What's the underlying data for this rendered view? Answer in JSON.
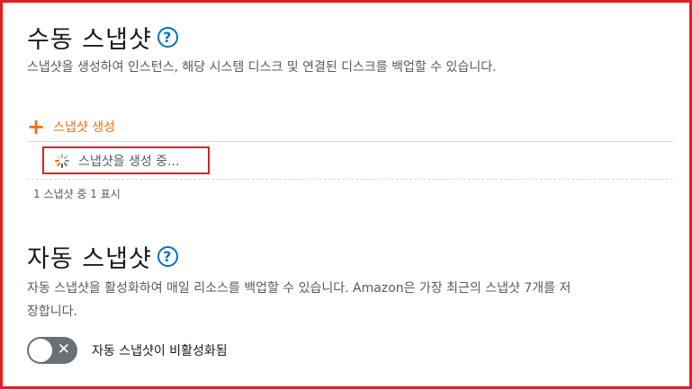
{
  "manual": {
    "title": "수동 스냅샷",
    "help_icon": "?",
    "description": "스냅샷을 생성하여 인스턴스, 해당 시스템 디스크 및 연결된 디스크를 백업할 수 있습니다.",
    "create_label": "스냅샷 생성",
    "create_icon": "plus-icon",
    "progress_label": "스냅샷을 생성 중...",
    "progress_icon": "spinner-icon",
    "count_text": "1 스냅샷 중 1 표시"
  },
  "automatic": {
    "title": "자동 스냅샷",
    "help_icon": "?",
    "description": "자동 스냅샷을 활성화하여 매일 리소스를 백업할 수 있습니다. Amazon은 가장 최근의 스냅샷 7개를 저장합니다.",
    "toggle_state": "off",
    "toggle_label": "자동 스냅샷이 비활성화됨"
  },
  "colors": {
    "accent_orange": "#ec7211",
    "help_blue": "#0073bb",
    "highlight_red": "#e0201f",
    "toggle_off": "#687078"
  }
}
